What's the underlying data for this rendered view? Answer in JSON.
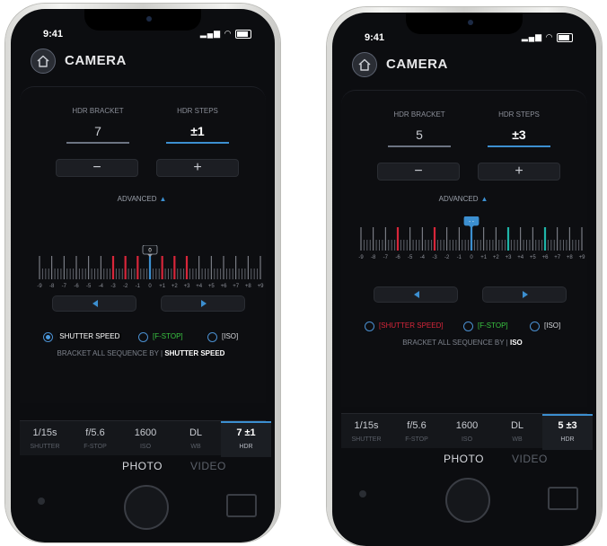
{
  "phones": [
    {
      "status_time": "9:41",
      "title": "CAMERA",
      "hdr_bracket_label": "HDR BRACKET",
      "hdr_bracket_value": "7",
      "hdr_steps_label": "HDR STEPS",
      "hdr_steps_value": "±1",
      "active_field": "steps",
      "minus": "−",
      "plus": "+",
      "advanced_label": "ADVANCED",
      "scale_ticks": [
        "-9",
        "-8",
        "-7",
        "-6",
        "-5",
        "-4",
        "-3",
        "-2",
        "-1",
        "0",
        "+1",
        "+2",
        "+3",
        "+4",
        "+5",
        "+6",
        "+7",
        "+8",
        "+9"
      ],
      "marker_label": "0",
      "highlighted_ticks": [
        "-3",
        "-2",
        "-1",
        "+1",
        "+2",
        "+3"
      ],
      "highlight_color": "#d8263a",
      "current_tick": "0",
      "options": [
        {
          "label": "SHUTTER SPEED",
          "selected": true,
          "color": "#ffffff"
        },
        {
          "label": "F-STOP",
          "selected": false,
          "color": "#39c441"
        },
        {
          "label": "ISO",
          "selected": false,
          "color": "#d8dade"
        }
      ],
      "bracket_by_text": "BRACKET ALL SEQUENCE BY |",
      "bracket_by_value": "SHUTTER SPEED",
      "tabs": [
        {
          "value": "1/15s",
          "label": "SHUTTER"
        },
        {
          "value": "f/5.6",
          "label": "F-STOP"
        },
        {
          "value": "1600",
          "label": "ISO"
        },
        {
          "value": "DL",
          "label": "WB"
        },
        {
          "value": "7 ±1",
          "label": "HDR",
          "active": true
        }
      ],
      "mode_photo": "PHOTO",
      "mode_video": "VIDEO"
    },
    {
      "status_time": "9:41",
      "title": "CAMERA",
      "hdr_bracket_label": "HDR BRACKET",
      "hdr_bracket_value": "5",
      "hdr_steps_label": "HDR STEPS",
      "hdr_steps_value": "±3",
      "active_field": "steps",
      "minus": "−",
      "plus": "+",
      "advanced_label": "ADVANCED",
      "scale_ticks": [
        "-9",
        "-8",
        "-7",
        "-6",
        "-5",
        "-4",
        "-3",
        "-2",
        "-1",
        "0",
        "+1",
        "+2",
        "+3",
        "+4",
        "+5",
        "+6",
        "+7",
        "+8",
        "+9"
      ],
      "marker_label": "- -",
      "highlighted_ticks": [
        "-6",
        "-3",
        "+3",
        "+6"
      ],
      "highlight_color": "#d8263a",
      "secondary_ticks": [
        "+3",
        "+6"
      ],
      "secondary_color": "#1fb5a8",
      "current_tick": "0",
      "options": [
        {
          "label": "SHUTTER SPEED",
          "selected": false,
          "color": "#d8263a"
        },
        {
          "label": "F-STOP",
          "selected": false,
          "color": "#39c441"
        },
        {
          "label": "ISO",
          "selected": false,
          "color": "#d8dade"
        }
      ],
      "bracket_by_text": "BRACKET ALL SEQUENCE BY |",
      "bracket_by_value": "ISO",
      "tabs": [
        {
          "value": "1/15s",
          "label": "SHUTTER"
        },
        {
          "value": "f/5.6",
          "label": "F-STOP"
        },
        {
          "value": "1600",
          "label": "ISO"
        },
        {
          "value": "DL",
          "label": "WB"
        },
        {
          "value": "5 ±3",
          "label": "HDR",
          "active": true
        }
      ],
      "mode_photo": "PHOTO",
      "mode_video": "VIDEO"
    }
  ],
  "colors": {
    "accent": "#3c8fd0",
    "background": "#0c0d10"
  }
}
